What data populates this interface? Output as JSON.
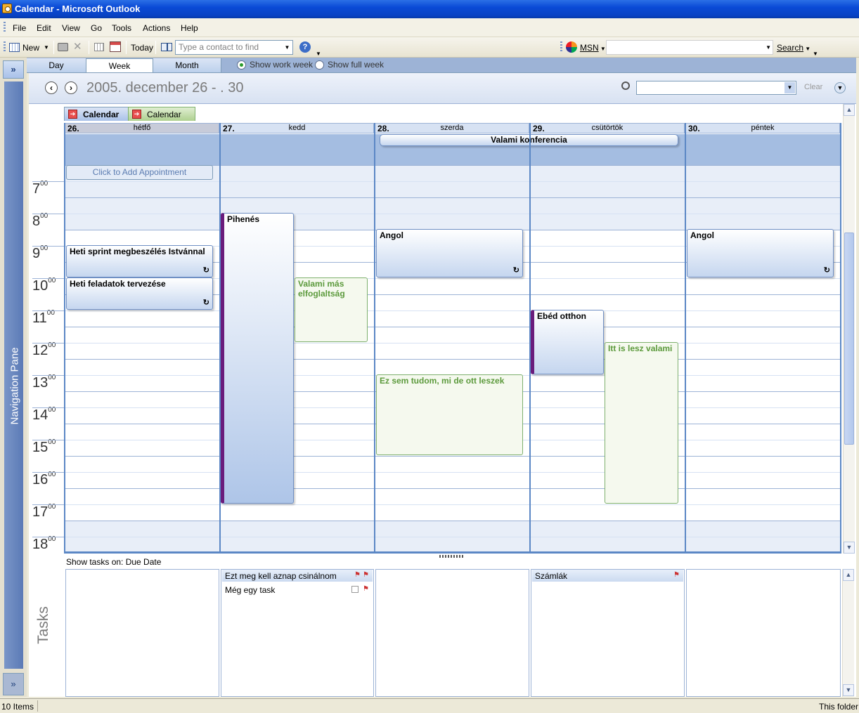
{
  "window": {
    "title": "Calendar - Microsoft Outlook"
  },
  "menu": [
    "File",
    "Edit",
    "View",
    "Go",
    "Tools",
    "Actions",
    "Help"
  ],
  "toolbar": {
    "new_label": "New",
    "today_label": "Today",
    "contact_placeholder": "Type a contact to find",
    "msn_label": "MSN",
    "search_label": "Search"
  },
  "nav_pane": {
    "label": "Navigation Pane",
    "collapse_glyph": "»",
    "expand_glyph": "»"
  },
  "view_tabs": {
    "day": "Day",
    "week": "Week",
    "month": "Month",
    "show_work_week": "Show work week",
    "show_full_week": "Show full week",
    "selected": "Week",
    "week_mode": "work"
  },
  "date_header": {
    "range": "2005. december 26 - . 30",
    "clear_label": "Clear"
  },
  "calendar_tabs": [
    "Calendar",
    "Calendar"
  ],
  "days": [
    {
      "num": "26.",
      "name": "hétfő"
    },
    {
      "num": "27.",
      "name": "kedd"
    },
    {
      "num": "28.",
      "name": "szerda"
    },
    {
      "num": "29.",
      "name": "csütörtök"
    },
    {
      "num": "30.",
      "name": "péntek"
    }
  ],
  "all_day_event": "Valami konferencia",
  "click_to_add": "Click to Add Appointment",
  "hours": [
    {
      "h": "7",
      "m": "00"
    },
    {
      "h": "8",
      "m": "00"
    },
    {
      "h": "9",
      "m": "00"
    },
    {
      "h": "10",
      "m": "00"
    },
    {
      "h": "11",
      "m": "00"
    },
    {
      "h": "12",
      "m": "00"
    },
    {
      "h": "13",
      "m": "00"
    },
    {
      "h": "14",
      "m": "00"
    },
    {
      "h": "15",
      "m": "00"
    },
    {
      "h": "16",
      "m": "00"
    },
    {
      "h": "17",
      "m": "00"
    },
    {
      "h": "18",
      "m": "00"
    }
  ],
  "appointments": {
    "a1": "Heti sprint megbeszélés Istvánnal",
    "a2": "Heti feladatok tervezése",
    "a3": "Pihenés",
    "a4": "Valami más elfoglaltság",
    "a5": "Angol",
    "a6": "Ez sem tudom, mi de ott leszek",
    "a7": "Ebéd otthon",
    "a8": "Itt is lesz valami",
    "a9": "Angol"
  },
  "recurring_glyph": "↻",
  "tasks": {
    "header": "Show tasks on: Due Date",
    "label": "Tasks",
    "t1": "Ezt meg kell aznap csinálnom",
    "t2": "Még egy task",
    "t3": "Számlák"
  },
  "status": {
    "items": "10 Items",
    "right": "This folder i"
  },
  "colors": {
    "accent": "#5b87c5",
    "busy": "#6a1c7c",
    "tentative": "#5c9a3c"
  }
}
